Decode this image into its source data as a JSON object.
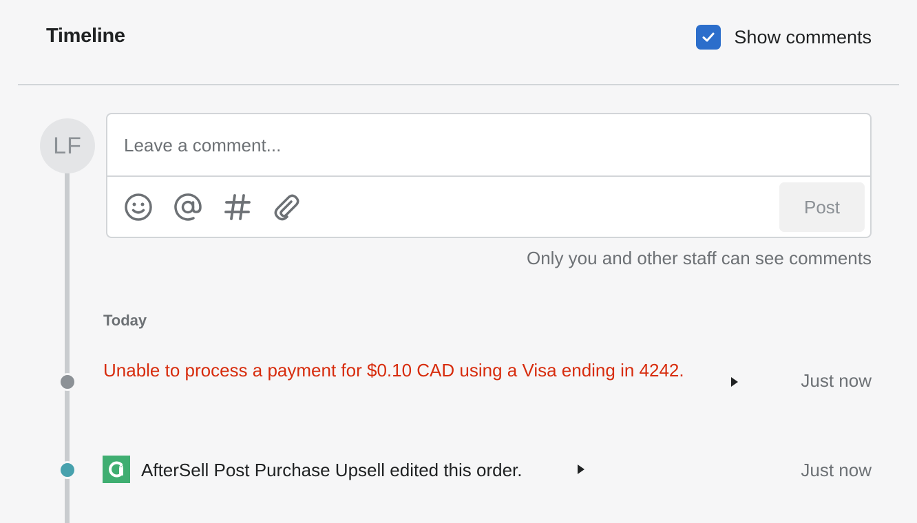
{
  "header": {
    "title": "Timeline",
    "show_comments_label": "Show comments",
    "show_comments_checked": true
  },
  "composer": {
    "avatar_initials": "LF",
    "placeholder": "Leave a comment...",
    "tools": [
      {
        "icon": "emoji-icon"
      },
      {
        "icon": "mention-icon"
      },
      {
        "icon": "hashtag-icon"
      },
      {
        "icon": "attachment-icon"
      }
    ],
    "post_label": "Post",
    "hint": "Only you and other staff can see comments"
  },
  "timeline": {
    "section_label": "Today",
    "events": [
      {
        "text": "Unable to process a payment for $0.10 CAD using a Visa ending in 4242.",
        "time": "Just now",
        "status_color": "#d72c0d"
      },
      {
        "text": "AfterSell Post Purchase Upsell edited this order.",
        "time": "Just now",
        "app_color": "#3fae71"
      }
    ]
  },
  "colors": {
    "accent": "#2c6ecb",
    "error": "#d72c0d",
    "app_dot": "#47a1ad"
  }
}
